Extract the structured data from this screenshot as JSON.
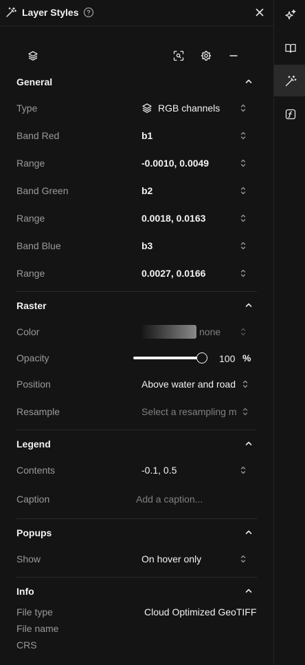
{
  "header": {
    "title": "Layer Styles"
  },
  "general": {
    "title": "General",
    "rows": [
      {
        "label": "Type",
        "value": "RGB channels"
      },
      {
        "label": "Band Red",
        "value": "b1"
      },
      {
        "label": "Range",
        "value": "-0.0010, 0.0049"
      },
      {
        "label": "Band Green",
        "value": "b2"
      },
      {
        "label": "Range",
        "value": "0.0018, 0.0163"
      },
      {
        "label": "Band Blue",
        "value": "b3"
      },
      {
        "label": "Range",
        "value": "0.0027, 0.0166"
      }
    ]
  },
  "raster": {
    "title": "Raster",
    "color_label": "Color",
    "color_value": "none",
    "opacity_label": "Opacity",
    "opacity_value": "100",
    "opacity_unit": "%",
    "opacity_fraction": 1.0,
    "position_label": "Position",
    "position_value": "Above water and road",
    "resample_label": "Resample",
    "resample_placeholder": "Select a resampling m"
  },
  "legend": {
    "title": "Legend",
    "contents_label": "Contents",
    "contents_value": "-0.1, 0.5",
    "caption_label": "Caption",
    "caption_placeholder": "Add a caption..."
  },
  "popups": {
    "title": "Popups",
    "show_label": "Show",
    "show_value": "On hover only"
  },
  "info": {
    "title": "Info",
    "file_type_label": "File type",
    "file_type_value": "Cloud Optimized GeoTIFF",
    "file_name_label": "File name",
    "crs_label": "CRS"
  },
  "colors": {
    "background": "#141414",
    "text": "#f2f2f2",
    "muted": "#9a9a9a",
    "divider": "#2a2a2a",
    "active_tab": "#2a2a2a"
  }
}
